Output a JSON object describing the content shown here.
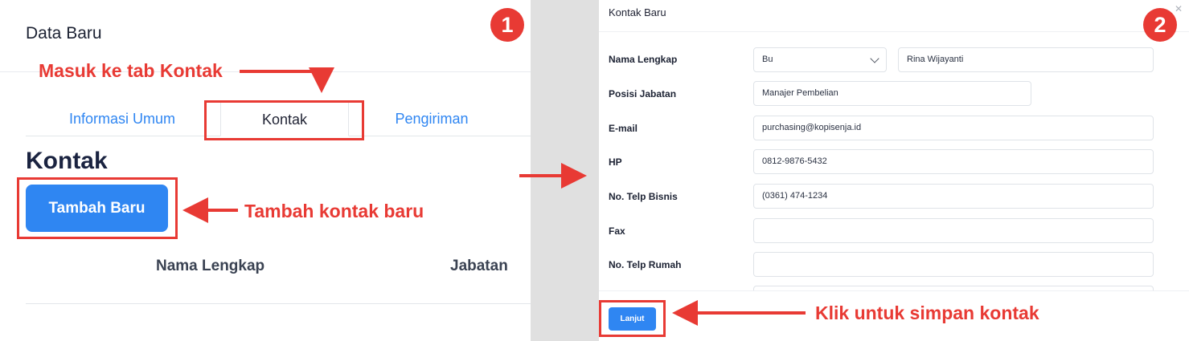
{
  "left_panel": {
    "title": "Data Baru",
    "tabs": [
      {
        "label": "Informasi Umum"
      },
      {
        "label": "Kontak"
      },
      {
        "label": "Pengiriman"
      }
    ],
    "section_title": "Kontak",
    "add_button": "Tambah Baru",
    "columns": [
      "Nama Lengkap",
      "Jabatan"
    ]
  },
  "modal": {
    "title": "Kontak Baru",
    "close_icon": "x-icon",
    "fields": [
      {
        "label": "Nama Lengkap",
        "salutation": "Bu",
        "value": "Rina Wijayanti"
      },
      {
        "label": "Posisi Jabatan",
        "value": "Manajer Pembelian"
      },
      {
        "label": "E-mail",
        "value": "purchasing@kopisenja.id"
      },
      {
        "label": "HP",
        "value": "0812-9876-5432"
      },
      {
        "label": "No. Telp Bisnis",
        "value": "(0361) 474-1234"
      },
      {
        "label": "Fax",
        "value": ""
      },
      {
        "label": "No. Telp Rumah",
        "value": ""
      }
    ],
    "submit_button": "Lanjut"
  },
  "annotations": {
    "badge1": "1",
    "badge2": "2",
    "tab_hint": "Masuk ke tab Kontak",
    "add_hint": "Tambah kontak baru",
    "save_hint": "Klik untuk simpan kontak",
    "color": "#e83a34"
  }
}
